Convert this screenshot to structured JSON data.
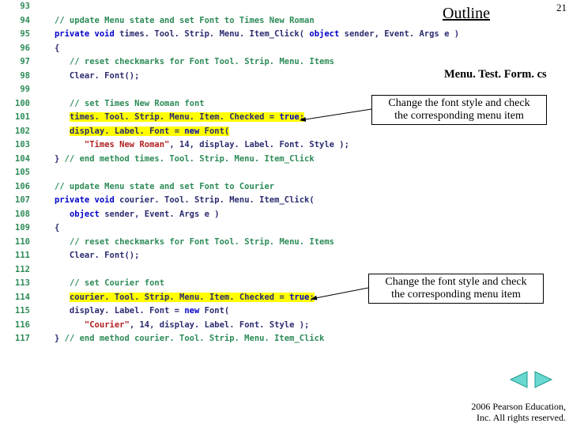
{
  "pageNumber": "21",
  "outlineTitle": "Outline",
  "fileName": "Menu. Test. Form. cs",
  "copyright": {
    "line1": "  2006 Pearson Education,",
    "line2": "Inc.  All rights reserved."
  },
  "callouts": {
    "c1": {
      "line1": "Change the font style and check",
      "line2": "the corresponding menu item"
    },
    "c2": {
      "line1": "Change the font style and check",
      "line2": "the corresponding menu item"
    }
  },
  "code": {
    "startLine": 93,
    "lines": {
      "93": {
        "tokens": [
          {
            "t": "",
            "cls": ""
          }
        ]
      },
      "94": {
        "tokens": [
          {
            "t": "   ",
            "cls": ""
          },
          {
            "t": "// update Menu state and set Font to Times New Roman",
            "cls": "c-green"
          }
        ]
      },
      "95": {
        "tokens": [
          {
            "t": "   ",
            "cls": ""
          },
          {
            "t": "private void",
            "cls": "c-blue"
          },
          {
            "t": " times. Tool. Strip. Menu. Item_Click( ",
            "cls": "c-navy"
          },
          {
            "t": "object",
            "cls": "c-blue"
          },
          {
            "t": " sender, Event. Args e )",
            "cls": "c-navy"
          }
        ]
      },
      "96": {
        "tokens": [
          {
            "t": "   {",
            "cls": "c-navy"
          }
        ]
      },
      "97": {
        "tokens": [
          {
            "t": "      ",
            "cls": ""
          },
          {
            "t": "// reset checkmarks for Font Tool. Strip. Menu. Items",
            "cls": "c-green"
          }
        ]
      },
      "98": {
        "tokens": [
          {
            "t": "      Clear. Font();",
            "cls": "c-navy"
          }
        ]
      },
      "99": {
        "tokens": [
          {
            "t": "",
            "cls": ""
          }
        ]
      },
      "100": {
        "tokens": [
          {
            "t": "      ",
            "cls": ""
          },
          {
            "t": "// set Times New Roman font",
            "cls": "c-green"
          }
        ]
      },
      "101": {
        "tokens": [
          {
            "t": "      ",
            "cls": ""
          },
          {
            "t": "times. Tool. Strip. Menu. Item. Checked = ",
            "cls": "c-navy",
            "hl": true
          },
          {
            "t": "true",
            "cls": "c-blue",
            "hl": true
          },
          {
            "t": ";",
            "cls": "c-navy",
            "hl": true
          }
        ]
      },
      "102": {
        "tokens": [
          {
            "t": "      ",
            "cls": ""
          },
          {
            "t": "display. Label. Font = ",
            "cls": "c-navy",
            "hl": true
          },
          {
            "t": "new",
            "cls": "c-blue",
            "hl": true
          },
          {
            "t": " Font(",
            "cls": "c-navy",
            "hl": true
          }
        ]
      },
      "103": {
        "tokens": [
          {
            "t": "         ",
            "cls": ""
          },
          {
            "t": "\"Times New Roman\"",
            "cls": "c-red"
          },
          {
            "t": ", 14, display. Label. Font. Style );",
            "cls": "c-navy"
          }
        ]
      },
      "104": {
        "tokens": [
          {
            "t": "   } ",
            "cls": "c-navy"
          },
          {
            "t": "// end method times. Tool. Strip. Menu. Item_Click",
            "cls": "c-green"
          }
        ]
      },
      "105": {
        "tokens": [
          {
            "t": "",
            "cls": ""
          }
        ]
      },
      "106": {
        "tokens": [
          {
            "t": "   ",
            "cls": ""
          },
          {
            "t": "// update Menu state and set Font to Courier",
            "cls": "c-green"
          }
        ]
      },
      "107": {
        "tokens": [
          {
            "t": "   ",
            "cls": ""
          },
          {
            "t": "private void",
            "cls": "c-blue"
          },
          {
            "t": " courier. Tool. Strip. Menu. Item_Click(",
            "cls": "c-navy"
          }
        ]
      },
      "108": {
        "tokens": [
          {
            "t": "      ",
            "cls": ""
          },
          {
            "t": "object",
            "cls": "c-blue"
          },
          {
            "t": " sender, Event. Args e )",
            "cls": "c-navy"
          }
        ]
      },
      "109": {
        "tokens": [
          {
            "t": "   {",
            "cls": "c-navy"
          }
        ]
      },
      "110": {
        "tokens": [
          {
            "t": "      ",
            "cls": ""
          },
          {
            "t": "// reset checkmarks for Font Tool. Strip. Menu. Items",
            "cls": "c-green"
          }
        ]
      },
      "111": {
        "tokens": [
          {
            "t": "      Clear. Font();",
            "cls": "c-navy"
          }
        ]
      },
      "112": {
        "tokens": [
          {
            "t": "",
            "cls": ""
          }
        ]
      },
      "113": {
        "tokens": [
          {
            "t": "      ",
            "cls": ""
          },
          {
            "t": "// set Courier font",
            "cls": "c-green"
          }
        ]
      },
      "114": {
        "tokens": [
          {
            "t": "      ",
            "cls": ""
          },
          {
            "t": "courier. Tool. Strip. Menu. Item. Checked = ",
            "cls": "c-navy",
            "hl": true
          },
          {
            "t": "true",
            "cls": "c-blue",
            "hl": true
          },
          {
            "t": ";",
            "cls": "c-navy",
            "hl": true
          }
        ]
      },
      "115": {
        "tokens": [
          {
            "t": "      display. Label. Font = ",
            "cls": "c-navy"
          },
          {
            "t": "new",
            "cls": "c-blue"
          },
          {
            "t": " Font(",
            "cls": "c-navy"
          }
        ]
      },
      "116": {
        "tokens": [
          {
            "t": "         ",
            "cls": ""
          },
          {
            "t": "\"Courier\"",
            "cls": "c-red"
          },
          {
            "t": ", 14, display. Label. Font. Style );",
            "cls": "c-navy"
          }
        ]
      },
      "117": {
        "tokens": [
          {
            "t": "   } ",
            "cls": "c-navy"
          },
          {
            "t": "// end method courier. Tool. Strip. Menu. Item_Click",
            "cls": "c-green"
          }
        ]
      }
    }
  }
}
